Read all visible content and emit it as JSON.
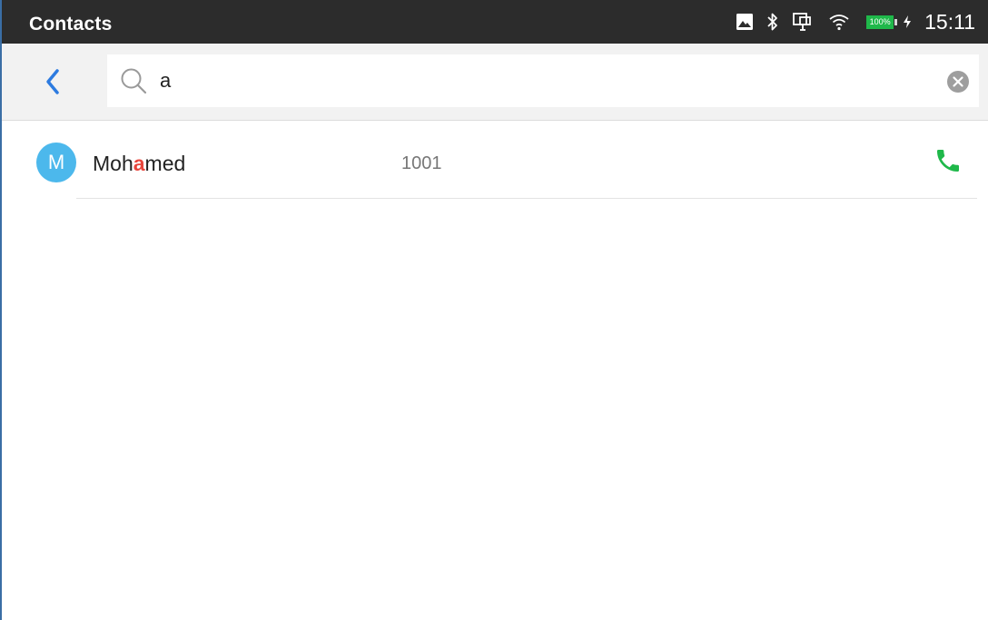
{
  "statusbar": {
    "app_title": "Contacts",
    "battery_percent": "100%",
    "time": "15:11",
    "icons": [
      "image-icon",
      "bluetooth-icon",
      "network-icon",
      "wifi-icon",
      "battery-icon",
      "charging-icon"
    ]
  },
  "search": {
    "query": "a",
    "placeholder": "",
    "icons": {
      "back": "back-arrow-icon",
      "search": "search-icon",
      "clear": "clear-icon"
    }
  },
  "contacts": [
    {
      "avatar_letter": "M",
      "name_before": "Moh",
      "name_match": "a",
      "name_after": "med",
      "number": "1001",
      "call_icon": "phone-icon"
    }
  ],
  "colors": {
    "status_bar": "#2c2c2c",
    "accent": "#2d7be0",
    "avatar": "#4cb8ec",
    "highlight": "#e8453c",
    "call": "#1fb84a",
    "battery": "#1fb84a"
  }
}
